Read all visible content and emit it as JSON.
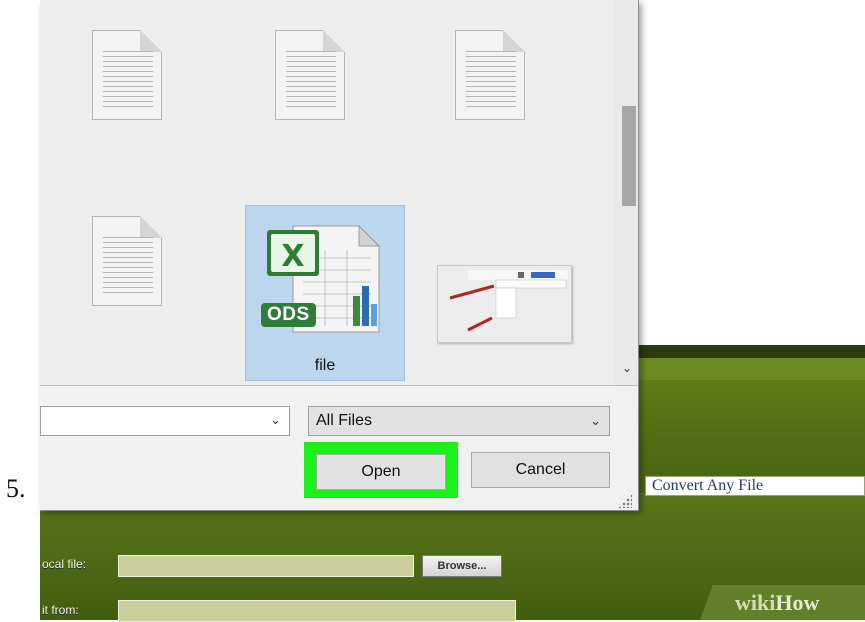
{
  "step": {
    "number": "5."
  },
  "dialog": {
    "selected_file": {
      "name": "file",
      "badge": "ODS"
    },
    "filetype": {
      "selected": "All Files"
    },
    "buttons": {
      "open": "Open",
      "cancel": "Cancel"
    },
    "highlight_color": "#1cf01c"
  },
  "background_site": {
    "convert_label": "Convert Any File",
    "local_file_label": "ocal file:",
    "get_from_label": "it from:",
    "browse_label": "Browse...",
    "brand_left": "wiki",
    "brand_right": "How",
    "accent_color": "#4e6a14"
  }
}
